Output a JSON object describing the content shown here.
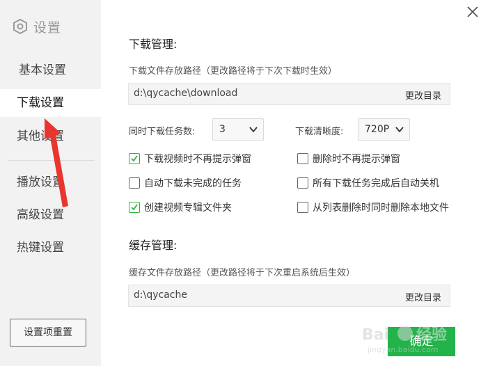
{
  "sidebar": {
    "title": "设置",
    "items": [
      {
        "label": "基本设置",
        "active": false
      },
      {
        "label": "下载设置",
        "active": true
      },
      {
        "label": "其他设置",
        "active": false
      },
      {
        "label": "播放设置",
        "active": false
      },
      {
        "label": "高级设置",
        "active": false
      },
      {
        "label": "热键设置",
        "active": false
      }
    ],
    "reset_label": "设置项重置"
  },
  "download": {
    "title": "下载管理:",
    "path_label": "下载文件存放路径（更改路径将于下次下载时生效）",
    "path_value": "d:\\qycache\\download",
    "change_dir": "更改目录",
    "tasks_label": "同时下载任务数:",
    "tasks_value": "3",
    "clarity_label": "下载清晰度:",
    "clarity_value": "720P",
    "options": [
      {
        "label": "下载视频时不再提示弹窗",
        "checked": true
      },
      {
        "label": "删除时不再提示弹窗",
        "checked": false
      },
      {
        "label": "自动下载未完成的任务",
        "checked": false
      },
      {
        "label": "所有下载任务完成后自动关机",
        "checked": false
      },
      {
        "label": "创建视频专辑文件夹",
        "checked": true
      },
      {
        "label": "从列表删除时同时删除本地文件",
        "checked": false
      }
    ]
  },
  "cache": {
    "title": "缓存管理:",
    "path_label": "缓存文件存放路径（更改路径将于下次重启系统后生效）",
    "path_value": "d:\\qycache",
    "change_dir": "更改目录"
  },
  "confirm_label": "确定",
  "watermark": "Baidu经验 jingyan.baidu.com",
  "colors": {
    "accent": "#22b34a",
    "arrow": "#e8352e",
    "sidebar_bg": "#f2f2f2"
  }
}
